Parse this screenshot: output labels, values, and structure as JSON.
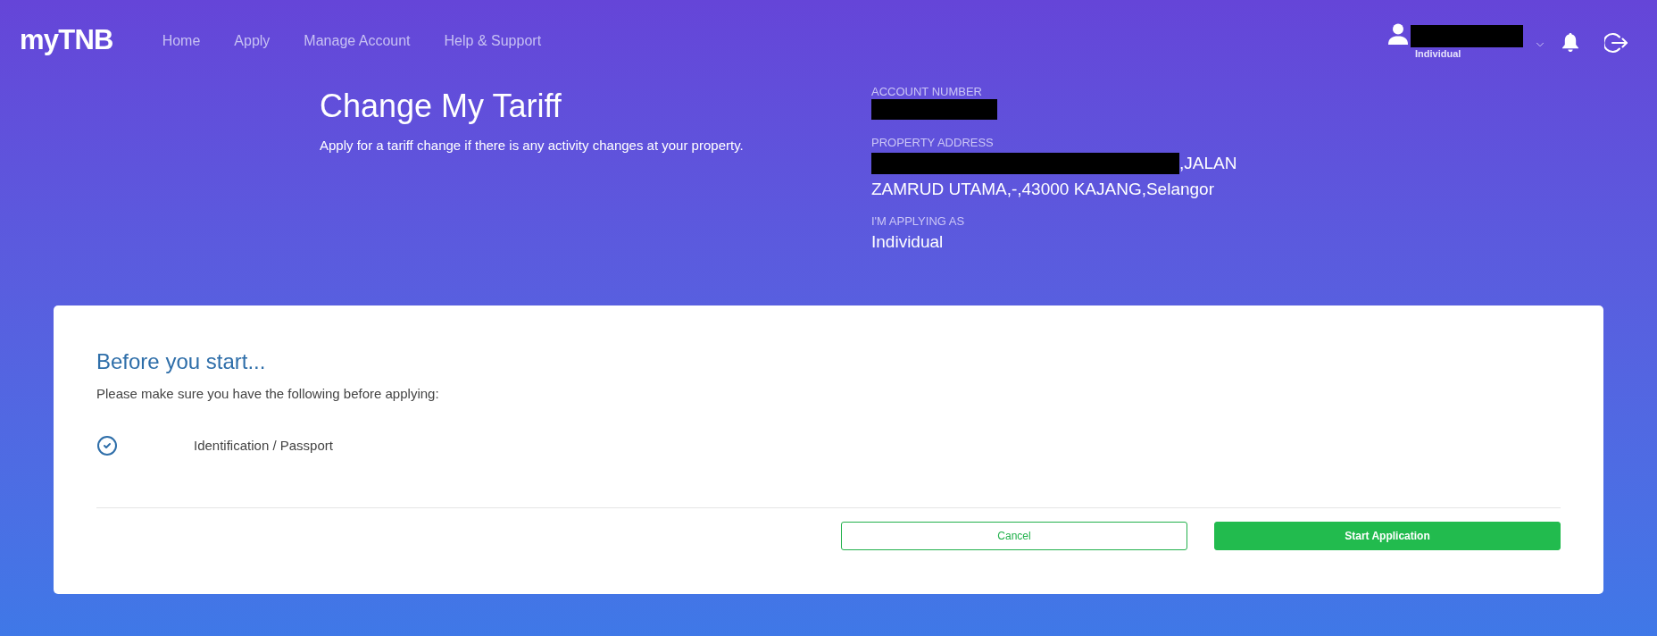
{
  "nav": {
    "logo": "myTNB",
    "items": [
      {
        "label": "Home"
      },
      {
        "label": "Apply"
      },
      {
        "label": "Manage Account"
      },
      {
        "label": "Help & Support"
      }
    ]
  },
  "user_menu": {
    "name_redacted": true,
    "role": "Individual"
  },
  "page_header": {
    "title": "Change My Tariff",
    "subtitle": "Apply for a tariff change if there is any activity changes at your property."
  },
  "account_number": {
    "label": "ACCOUNT NUMBER",
    "redacted": true
  },
  "property_address": {
    "label": "PROPERTY ADDRESS",
    "redacted": true,
    "lines": [
      ",JALAN",
      "ZAMRUD UTAMA,-,43000 KAJANG,Selangor"
    ]
  },
  "applying_as": {
    "label": "I'M APPLYING AS",
    "value": "Individual"
  },
  "card": {
    "title": "Before you start...",
    "intro": "Please make sure you have the following before applying:",
    "checklist": [
      {
        "label": "Identification / Passport",
        "checked": true
      }
    ],
    "buttons": [
      {
        "kind": "outline",
        "label": "Cancel"
      },
      {
        "kind": "primary",
        "label": "Start Application"
      }
    ]
  }
}
